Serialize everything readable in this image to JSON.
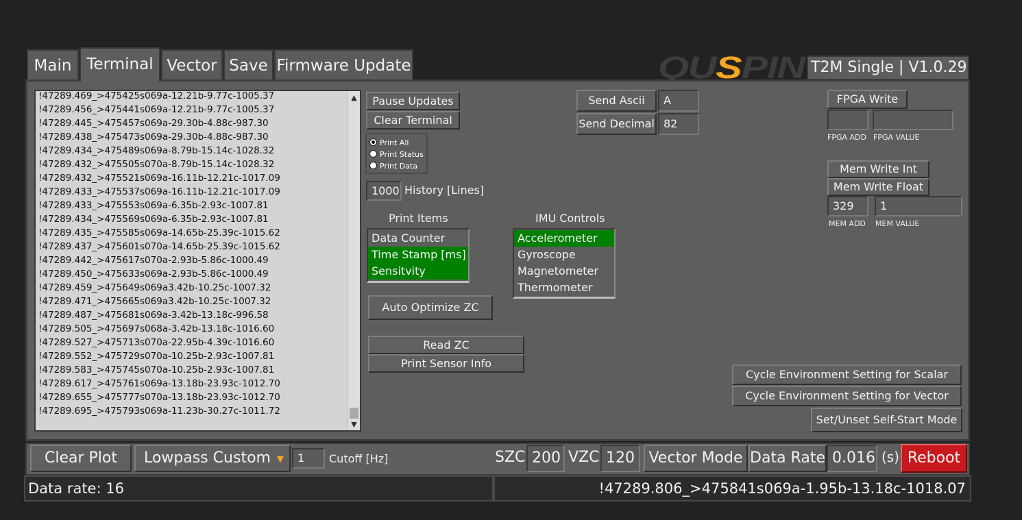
{
  "tabs": [
    {
      "label": "Main"
    },
    {
      "label": "Terminal"
    },
    {
      "label": "Vector"
    },
    {
      "label": "Save"
    },
    {
      "label": "Firmware Update"
    }
  ],
  "brand": {
    "logo_text": "QUSPIN",
    "product": "T2M Single | V1.0.29",
    "logo_gray": "#3d3d3d",
    "logo_accent": "#f5a623"
  },
  "terminal": {
    "lines": [
      "!47289.469_>475425s069a-12.21b-9.77c-1005.37",
      "!47289.456_>475441s069a-12.21b-9.77c-1005.37",
      "!47289.445_>475457s069a-29.30b-4.88c-987.30",
      "!47289.438_>475473s069a-29.30b-4.88c-987.30",
      "!47289.434_>475489s069a-8.79b-15.14c-1028.32",
      "!47289.432_>475505s070a-8.79b-15.14c-1028.32",
      "!47289.432_>475521s069a-16.11b-12.21c-1017.09",
      "!47289.433_>475537s069a-16.11b-12.21c-1017.09",
      "!47289.433_>475553s069a-6.35b-2.93c-1007.81",
      "!47289.434_>475569s069a-6.35b-2.93c-1007.81",
      "!47289.435_>475585s069a-14.65b-25.39c-1015.62",
      "!47289.437_>475601s070a-14.65b-25.39c-1015.62",
      "!47289.442_>475617s070a-2.93b-5.86c-1000.49",
      "!47289.450_>475633s069a-2.93b-5.86c-1000.49",
      "!47289.459_>475649s069a3.42b-10.25c-1007.32",
      "!47289.471_>475665s069a3.42b-10.25c-1007.32",
      "!47289.487_>475681s069a-3.42b-13.18c-996.58",
      "!47289.505_>475697s068a-3.42b-13.18c-1016.60",
      "!47289.527_>475713s070a-22.95b-4.39c-1016.60",
      "!47289.552_>475729s070a-10.25b-2.93c-1007.81",
      "!47289.583_>475745s070a-10.25b-2.93c-1007.81",
      "!47289.617_>475761s069a-13.18b-23.93c-1012.70",
      "!47289.655_>475777s070a-13.18b-23.93c-1012.70",
      "!47289.695_>475793s069a-11.23b-30.27c-1011.72"
    ],
    "scroll_up": "▲",
    "scroll_down": "▼"
  },
  "controls": {
    "pause_updates": "Pause Updates",
    "clear_terminal": "Clear Terminal",
    "print_options": [
      {
        "label": "Print All",
        "selected": true
      },
      {
        "label": "Print Status",
        "selected": false
      },
      {
        "label": "Print Data",
        "selected": false
      }
    ],
    "history_value": "1000",
    "history_label": "History [Lines]",
    "print_items_title": "Print Items",
    "print_items": [
      {
        "label": "Data Counter",
        "selected": false
      },
      {
        "label": "Time Stamp [ms]",
        "selected": true
      },
      {
        "label": "Sensitvity",
        "selected": true
      }
    ],
    "imu_title": "IMU Controls",
    "imu_items": [
      {
        "label": "Accelerometer",
        "selected": true
      },
      {
        "label": "Gyroscope",
        "selected": false
      },
      {
        "label": "Magnetometer",
        "selected": false
      },
      {
        "label": "Thermometer",
        "selected": false
      }
    ],
    "auto_optimize": "Auto Optimize ZC",
    "read_zc": "Read ZC",
    "print_sensor_info": "Print Sensor Info",
    "send_ascii": "Send Ascii",
    "send_ascii_value": "A",
    "send_decimal": "Send Decimal",
    "send_decimal_value": "82",
    "fpga_write": "FPGA Write",
    "fpga_add_value": "",
    "fpga_value_value": "",
    "fpga_add_label": "FPGA ADD",
    "fpga_value_label": "FPGA VALUE",
    "mem_write_int": "Mem Write Int",
    "mem_write_float": "Mem Write Float",
    "mem_add_value": "329",
    "mem_value_value": "1",
    "mem_add_label": "MEM ADD",
    "mem_value_label": "MEM VALUE",
    "cycle_scalar": "Cycle Environment Setting for Scalar",
    "cycle_vector": "Cycle Environment Setting for Vector",
    "self_start": "Set/Unset Self-Start Mode"
  },
  "bottom": {
    "clear_plot": "Clear Plot",
    "filter": "Lowpass Custom",
    "cutoff_value": "1",
    "cutoff_label": "Cutoff [Hz]",
    "szc_label": "SZC",
    "szc_value": "200",
    "vzc_label": "VZC",
    "vzc_value": "120",
    "vector_mode": "Vector Mode",
    "data_rate_label": "Data Rate",
    "data_rate_value": "0.016",
    "unit": "(s)",
    "reboot": "Reboot",
    "reboot_color": "#c8191e"
  },
  "status": {
    "data_rate": "Data rate: 16",
    "last_line": "!47289.806_>475841s069a-1.95b-13.18c-1018.07"
  }
}
